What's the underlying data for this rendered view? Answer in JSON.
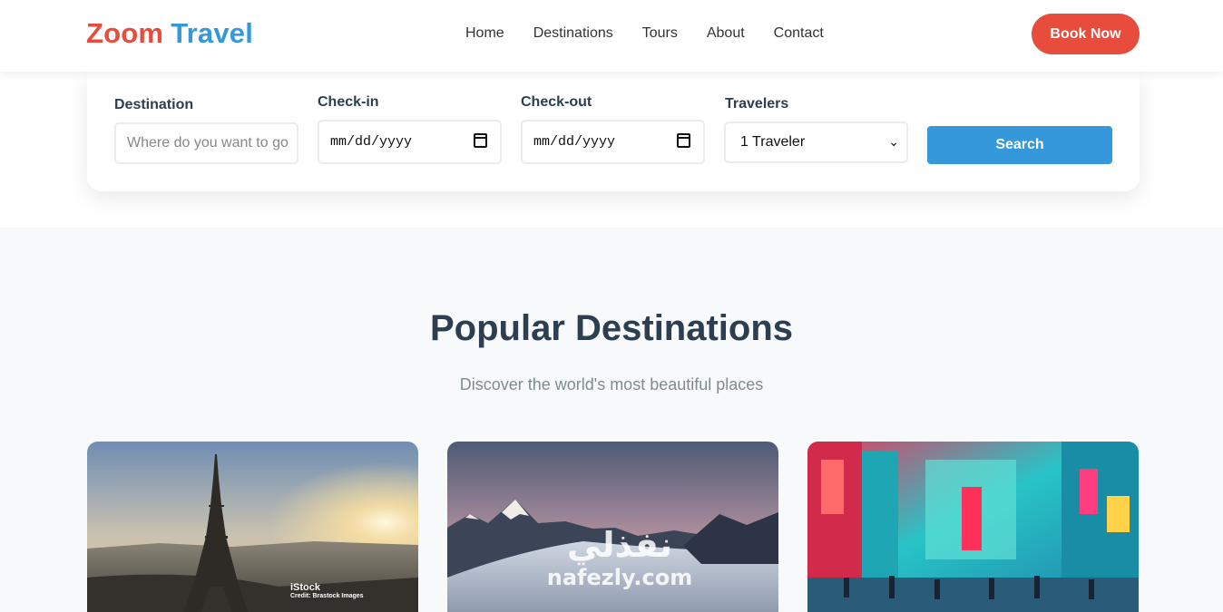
{
  "header": {
    "logo_word1": "Zoom",
    "logo_word2": "Travel",
    "nav": [
      "Home",
      "Destinations",
      "Tours",
      "About",
      "Contact"
    ],
    "book_label": "Book Now"
  },
  "search": {
    "destination_label": "Destination",
    "destination_placeholder": "Where do you want to go",
    "checkin_label": "Check-in",
    "checkin_value": "mm/dd/yyyy",
    "checkout_label": "Check-out",
    "checkout_value": "mm/dd/yyyy",
    "travelers_label": "Travelers",
    "travelers_value": "1 Traveler",
    "search_label": "Search"
  },
  "popular": {
    "title": "Popular Destinations",
    "subtitle": "Discover the world's most beautiful places",
    "cards": [
      {
        "image": "eiffel-tower-paris",
        "credit_brand": "iStock",
        "credit_text": "Credit: Brastock Images"
      },
      {
        "image": "snowy-mountains-sunset",
        "watermark_ar": "نفذلي",
        "watermark_lat": "nafezly.com"
      },
      {
        "image": "tokyo-neon-street"
      }
    ]
  },
  "colors": {
    "brand_red": "#e74c3c",
    "brand_blue": "#3498db",
    "heading": "#2c3e50",
    "muted": "#7f8c8d"
  }
}
